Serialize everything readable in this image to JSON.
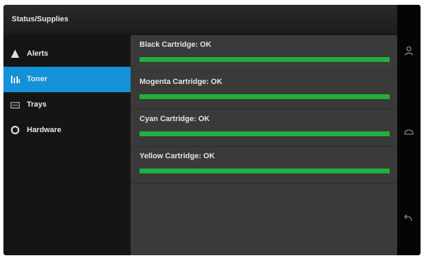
{
  "header": {
    "title": "Status/Supplies"
  },
  "sidebar": {
    "items": [
      {
        "label": "Alerts",
        "icon": "alert-triangle-icon",
        "selected": false
      },
      {
        "label": "Toner",
        "icon": "toner-bars-icon",
        "selected": true
      },
      {
        "label": "Trays",
        "icon": "tray-icon",
        "selected": false
      },
      {
        "label": "Hardware",
        "icon": "hardware-ring-icon",
        "selected": false
      }
    ]
  },
  "cartridges": [
    {
      "label": "Black Cartridge: OK",
      "level": 1.0
    },
    {
      "label": "Mogenta Cartridge: OK",
      "level": 1.0
    },
    {
      "label": "Cyan Cartridge: OK",
      "level": 1.0
    },
    {
      "label": "Yellow Cartridge: OK",
      "level": 1.0
    }
  ],
  "colors": {
    "accent": "#1492d9",
    "level_ok": "#22b03a"
  },
  "system_buttons": [
    {
      "icon": "person-icon"
    },
    {
      "icon": "home-icon"
    },
    {
      "icon": "back-icon"
    }
  ]
}
